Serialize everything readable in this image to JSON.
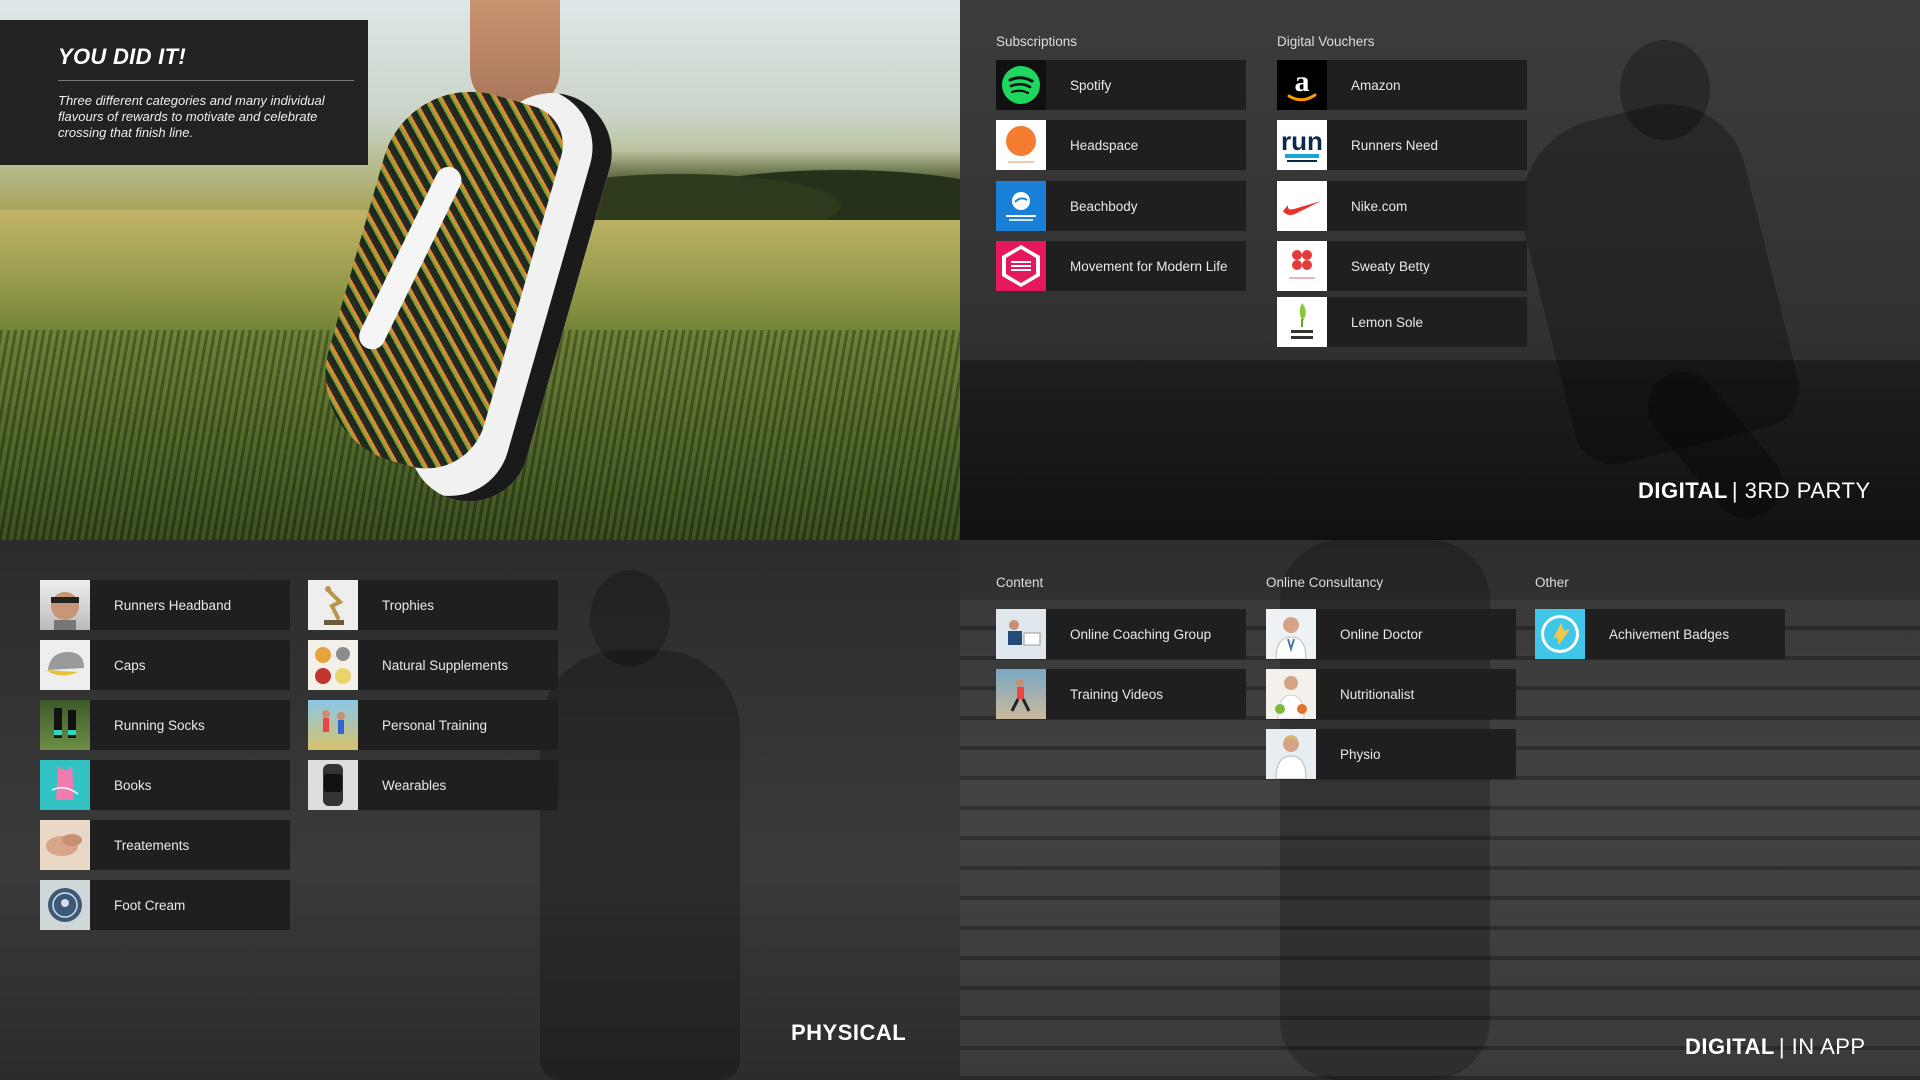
{
  "intro": {
    "title": "YOU DID IT!",
    "body": "Three different categories and many individual flavours of rewards to motivate and celebrate crossing that finish line."
  },
  "third_party": {
    "label_bold": "DIGITAL",
    "label_rest": "| 3RD PARTY",
    "subscriptions": {
      "title": "Subscriptions",
      "items": [
        {
          "label": "Spotify",
          "icon": "spotify-logo-icon",
          "color": "#1ed760"
        },
        {
          "label": "Headspace",
          "icon": "headspace-logo-icon",
          "color": "#f47d31"
        },
        {
          "label": "Beachbody",
          "icon": "beachbody-logo-icon",
          "color": "#1a7fd6"
        },
        {
          "label": "Movement for Modern Life",
          "icon": "movement-logo-icon",
          "color": "#e5185c"
        }
      ]
    },
    "vouchers": {
      "title": "Digital Vouchers",
      "items": [
        {
          "label": "Amazon",
          "icon": "amazon-logo-icon",
          "color": "#000000"
        },
        {
          "label": "Runners Need",
          "icon": "runners-need-logo-icon",
          "color": "#ffffff"
        },
        {
          "label": "Nike.com",
          "icon": "nike-logo-icon",
          "color": "#ffffff"
        },
        {
          "label": "Sweaty Betty",
          "icon": "sweaty-betty-logo-icon",
          "color": "#ffffff"
        },
        {
          "label": "Lemon Sole",
          "icon": "lemon-sole-logo-icon",
          "color": "#ffffff"
        }
      ]
    }
  },
  "physical": {
    "label": "PHYSICAL",
    "col1": [
      {
        "label": "Runners Headband",
        "icon": "headband-photo-icon"
      },
      {
        "label": "Caps",
        "icon": "cap-photo-icon"
      },
      {
        "label": "Running Socks",
        "icon": "socks-photo-icon"
      },
      {
        "label": "Books",
        "icon": "book-photo-icon"
      },
      {
        "label": "Treatements",
        "icon": "treatment-photo-icon"
      },
      {
        "label": "Foot Cream",
        "icon": "foot-cream-photo-icon"
      }
    ],
    "col2": [
      {
        "label": "Trophies",
        "icon": "trophy-photo-icon"
      },
      {
        "label": "Natural Supplements",
        "icon": "supplements-photo-icon"
      },
      {
        "label": "Personal Training",
        "icon": "training-photo-icon"
      },
      {
        "label": "Wearables",
        "icon": "wearable-photo-icon"
      }
    ]
  },
  "in_app": {
    "label_bold": "DIGITAL",
    "label_rest": "| IN APP",
    "content": {
      "title": "Content",
      "items": [
        {
          "label": "Online Coaching Group",
          "icon": "coaching-photo-icon"
        },
        {
          "label": "Training Videos",
          "icon": "video-photo-icon"
        }
      ]
    },
    "consultancy": {
      "title": "Online Consultancy",
      "items": [
        {
          "label": "Online Doctor",
          "icon": "doctor-photo-icon"
        },
        {
          "label": "Nutritionalist",
          "icon": "nutritionist-photo-icon"
        },
        {
          "label": "Physio",
          "icon": "physio-photo-icon"
        }
      ]
    },
    "other": {
      "title": "Other",
      "items": [
        {
          "label": "Achivement Badges",
          "icon": "badge-icon",
          "color": "#3fc6e8"
        }
      ]
    }
  }
}
